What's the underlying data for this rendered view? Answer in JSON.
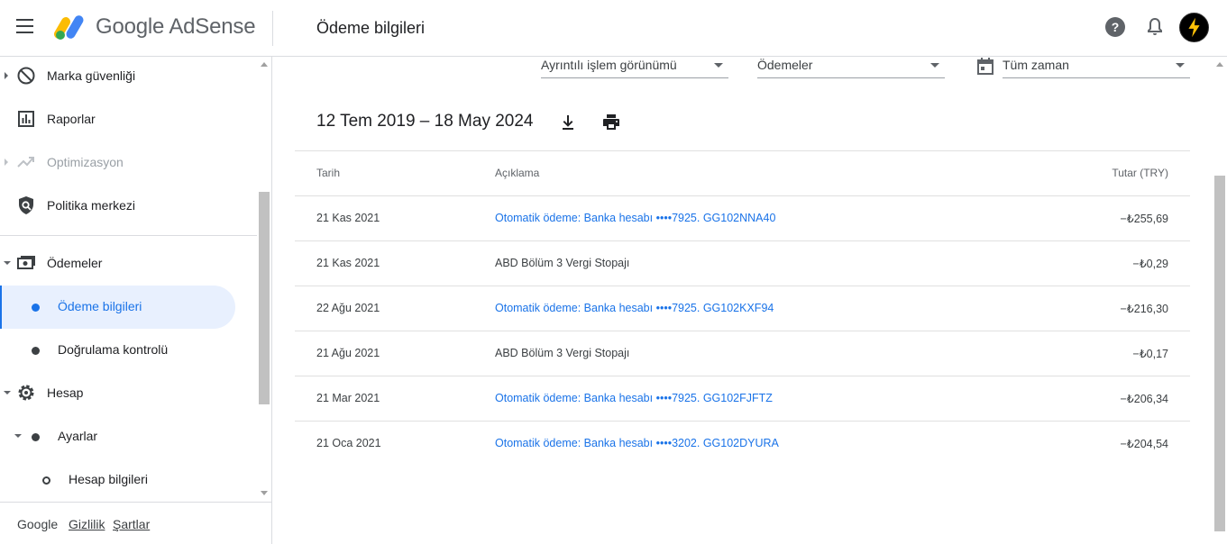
{
  "header": {
    "brand": "Google AdSense",
    "page_title": "Ödeme bilgileri"
  },
  "sidebar": {
    "items": [
      {
        "label": "Marka güvenliği"
      },
      {
        "label": "Raporlar"
      },
      {
        "label": "Optimizasyon"
      },
      {
        "label": "Politika merkezi"
      },
      {
        "label": "Ödemeler"
      },
      {
        "label": "Ödeme bilgileri"
      },
      {
        "label": "Doğrulama kontrolü"
      },
      {
        "label": "Hesap"
      },
      {
        "label": "Ayarlar"
      },
      {
        "label": "Hesap bilgileri"
      }
    ]
  },
  "footer": {
    "google": "Google",
    "privacy": "Gizlilik",
    "terms": "Şartlar"
  },
  "filters": {
    "view": "Ayrıntılı işlem görünümü",
    "type": "Ödemeler",
    "period": "Tüm zaman"
  },
  "range": "12 Tem 2019 – 18 May 2024",
  "table": {
    "headers": {
      "date": "Tarih",
      "description": "Açıklama",
      "amount": "Tutar (TRY)"
    },
    "rows": [
      {
        "date": "21 Kas 2021",
        "description": "Otomatik ödeme: Banka hesabı   ••••7925. GG102NNA40",
        "amount": "−₺255,69"
      },
      {
        "date": "21 Kas 2021",
        "description": "ABD Bölüm 3 Vergi Stopajı",
        "amount": "−₺0,29"
      },
      {
        "date": "22 Ağu 2021",
        "description": "Otomatik ödeme: Banka hesabı   ••••7925. GG102KXF94",
        "amount": "−₺216,30"
      },
      {
        "date": "21 Ağu 2021",
        "description": "ABD Bölüm 3 Vergi Stopajı",
        "amount": "−₺0,17"
      },
      {
        "date": "21 Mar 2021",
        "description": "Otomatik ödeme: Banka hesabı   ••••7925. GG102FJFTZ",
        "amount": "−₺206,34"
      },
      {
        "date": "21 Oca 2021",
        "description": "Otomatik ödeme: Banka hesabı   ••••3202. GG102DYURA",
        "amount": "−₺204,54"
      }
    ]
  },
  "colors": {
    "accent": "#1a73e8",
    "active_bg": "#e8f0fe"
  }
}
